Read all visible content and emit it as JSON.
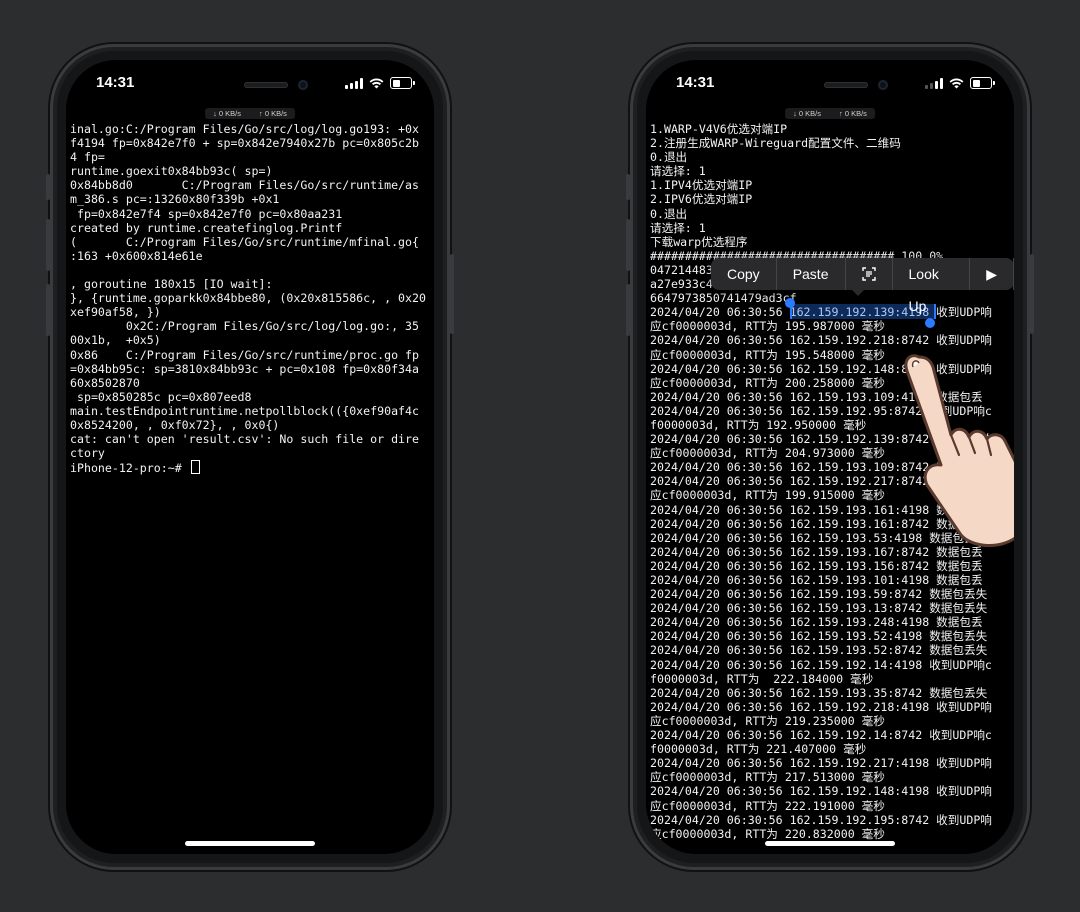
{
  "left_phone": {
    "status": {
      "time": "14:31",
      "net_down": "↓ 0 KB/s",
      "net_up": "↑ 0 KB/s"
    },
    "terminal_lines": [
      "inal.go:C:/Program Files/Go/src/log/log.go193: +0x",
      "f4194 fp=0x842e7f0 + sp=0x842e7940x27b pc=0x805c2b",
      "4 fp=",
      "runtime.goexit0x84bb93c( sp=)",
      "0x84bb8d0       C:/Program Files/Go/src/runtime/as",
      "m_386.s pc=:13260x80f339b +0x1",
      " fp=0x842e7f4 sp=0x842e7f0 pc=0x80aa231",
      "created by runtime.createfinglog.Printf",
      "(       C:/Program Files/Go/src/runtime/mfinal.go{",
      ":163 +0x600x814e61e",
      "",
      ", goroutine 180x15 [IO wait]:",
      "}, {runtime.goparkk0x84bbe80, (0x20x815586c, , 0x20",
      "xef90af58, })",
      "        0x2C:/Program Files/Go/src/log/log.go:, 35",
      "00x1b,  +0x5)",
      "0x86    C:/Program Files/Go/src/runtime/proc.go fp",
      "=0x84bb95c: sp=3810x84bb93c + pc=0x108 fp=0x80f34a",
      "60x8502870",
      " sp=0x850285c pc=0x807eed8",
      "main.testEndpointruntime.netpollblock(({0xef90af4c",
      "0x8524200, , 0xf0x72}, , 0x0{)",
      "cat: can't open 'result.csv': No such file or dire",
      "ctory"
    ],
    "prompt": "iPhone-12-pro:~# "
  },
  "right_phone": {
    "status": {
      "time": "14:31",
      "net_down": "↓ 0 KB/s",
      "net_up": "↑ 0 KB/s"
    },
    "context_menu": {
      "copy": "Copy",
      "paste": "Paste",
      "scan_icon": "text-scan-icon",
      "lookup": "Look Up",
      "more": "▶"
    },
    "selected_text": "162.159.192.139:4198",
    "terminal_lines": [
      "1.WARP-V4V6优选对端IP",
      "2.注册生成WARP-Wireguard配置文件、二维码",
      "0.退出",
      "请选择: 1",
      "1.IPV4优选对端IP",
      "2.IPV6优选对端IP",
      "0.退出",
      "请选择: 1",
      "下载warp优选程序",
      "################################### 100.0%",
      "047214483",
      "a27e933c4",
      "6647973850741479ad3cf",
      "2024/04/20 06:30:56 162.159.192.139:4198 收到UDP响",
      "应cf0000003d, RTT为 195.987000 毫秒",
      "2024/04/20 06:30:56 162.159.192.218:8742 收到UDP响",
      "应cf0000003d, RTT为 195.548000 毫秒",
      "2024/04/20 06:30:56 162.159.192.148:8742 收到UDP响",
      "应cf0000003d, RTT为 200.258000 毫秒",
      "2024/04/20 06:30:56 162.159.193.109:4198 数据包丢",
      "2024/04/20 06:30:56 162.159.192.95:8742 收到UDP响c",
      "f0000003d, RTT为 192.950000 毫秒",
      "2024/04/20 06:30:56 162.159.192.139:8742 收到UDP响",
      "应cf0000003d, RTT为 204.973000 毫秒",
      "2024/04/20 06:30:56 162.159.193.109:8742 收到UDP响",
      "2024/04/20 06:30:56 162.159.192.217:8742 收到UDP响",
      "应cf0000003d, RTT为 199.915000 毫秒",
      "2024/04/20 06:30:56 162.159.193.161:4198 数据包丢",
      "2024/04/20 06:30:56 162.159.193.161:8742 数据包丢",
      "2024/04/20 06:30:56 162.159.193.53:4198 数据包丢失",
      "2024/04/20 06:30:56 162.159.193.167:8742 数据包丢",
      "2024/04/20 06:30:56 162.159.193.156:8742 数据包丢",
      "2024/04/20 06:30:56 162.159.193.101:4198 数据包丢",
      "2024/04/20 06:30:56 162.159.193.59:8742 数据包丢失",
      "2024/04/20 06:30:56 162.159.193.13:8742 数据包丢失",
      "2024/04/20 06:30:56 162.159.193.248:4198 数据包丢",
      "2024/04/20 06:30:56 162.159.193.52:4198 数据包丢失",
      "2024/04/20 06:30:56 162.159.193.52:8742 数据包丢失",
      "2024/04/20 06:30:56 162.159.192.14:4198 收到UDP响c",
      "f0000003d, RTT为  222.184000 毫秒",
      "2024/04/20 06:30:56 162.159.193.35:8742 数据包丢失",
      "2024/04/20 06:30:56 162.159.192.218:4198 收到UDP响",
      "应cf0000003d, RTT为 219.235000 毫秒",
      "2024/04/20 06:30:56 162.159.192.14:8742 收到UDP响c",
      "f0000003d, RTT为 221.407000 毫秒",
      "2024/04/20 06:30:56 162.159.192.217:4198 收到UDP响",
      "应cf0000003d, RTT为 217.513000 毫秒",
      "2024/04/20 06:30:56 162.159.192.148:4198 收到UDP响",
      "应cf0000003d, RTT为 222.191000 毫秒",
      "2024/04/20 06:30:56 162.159.192.195:8742 收到UDP响",
      "应cf0000003d, RTT为 220.832000 毫秒"
    ]
  }
}
